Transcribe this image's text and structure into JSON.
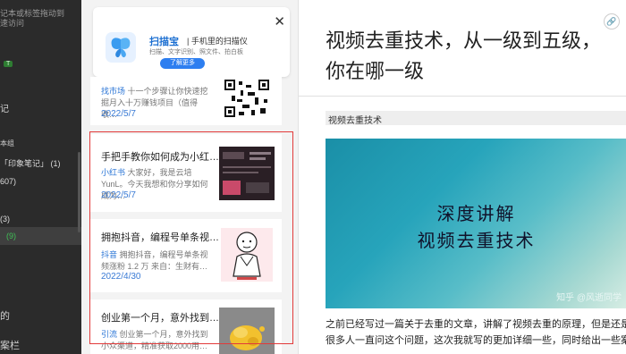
{
  "sidebar": {
    "hint_line1": "记本或标签拖动到",
    "hint_line2": "速访问",
    "badge": "T",
    "notes_label": "记",
    "sub_label": "本组",
    "notebook_entry": "「印象笔记」 (1)",
    "count_entry": "607)",
    "three_entry": "(3)",
    "active_entry": "(9)",
    "tag_label": "",
    "de_label": "的",
    "dang_label": "案栏"
  },
  "ad": {
    "name": "扫描宝",
    "slogan": "| 手机里的扫描仪",
    "features": "扫描、文字识别、照文件、拍白板",
    "more_label": "了解更多",
    "close_glyph": "✕"
  },
  "cards": [
    {
      "title": "",
      "source": "找市场",
      "snippet": "十一个步骤让你快速挖掘月入十万赚钱项目（值得收…",
      "date": "2022/5/7"
    },
    {
      "title": "手把手教你如何成为小红…",
      "source": "小红书",
      "snippet": "大家好，我是云培YunL。今天我想和你分享如何成为…",
      "date": "2022/5/7"
    },
    {
      "title": "拥抱抖音，编程号单条视…",
      "source": "抖音",
      "snippet": "拥抱抖音，编程号单条视频涨粉 1.2 万 来自：生财有…",
      "date": "2022/4/30"
    },
    {
      "title": "创业第一个月，意外找到…",
      "source": "引流",
      "snippet": "创业第一个月，意外找到小众渠道，精准获取2000用…",
      "date": ""
    }
  ],
  "article": {
    "title": "视频去重技术，从一级到五级，你在哪一级",
    "link_glyph": "🔗",
    "heading": "视频去重技术",
    "hero_line1": "深度讲解",
    "hero_line2": "视频去重技术",
    "hero_watermark": "知乎 @风逝同学",
    "para_line1": "之前已经写过一篇关于去重的文章，讲解了视频去重的原理，但是还是有",
    "para_line2": "很多人一直问这个问题，这次我就写的更加详细一些，同时给出一些案"
  },
  "colors": {
    "sidebar_bg": "#2b2b2b",
    "accent_blue": "#2a75d6",
    "highlight_red": "#e23a3a",
    "active_green": "#40c057"
  }
}
